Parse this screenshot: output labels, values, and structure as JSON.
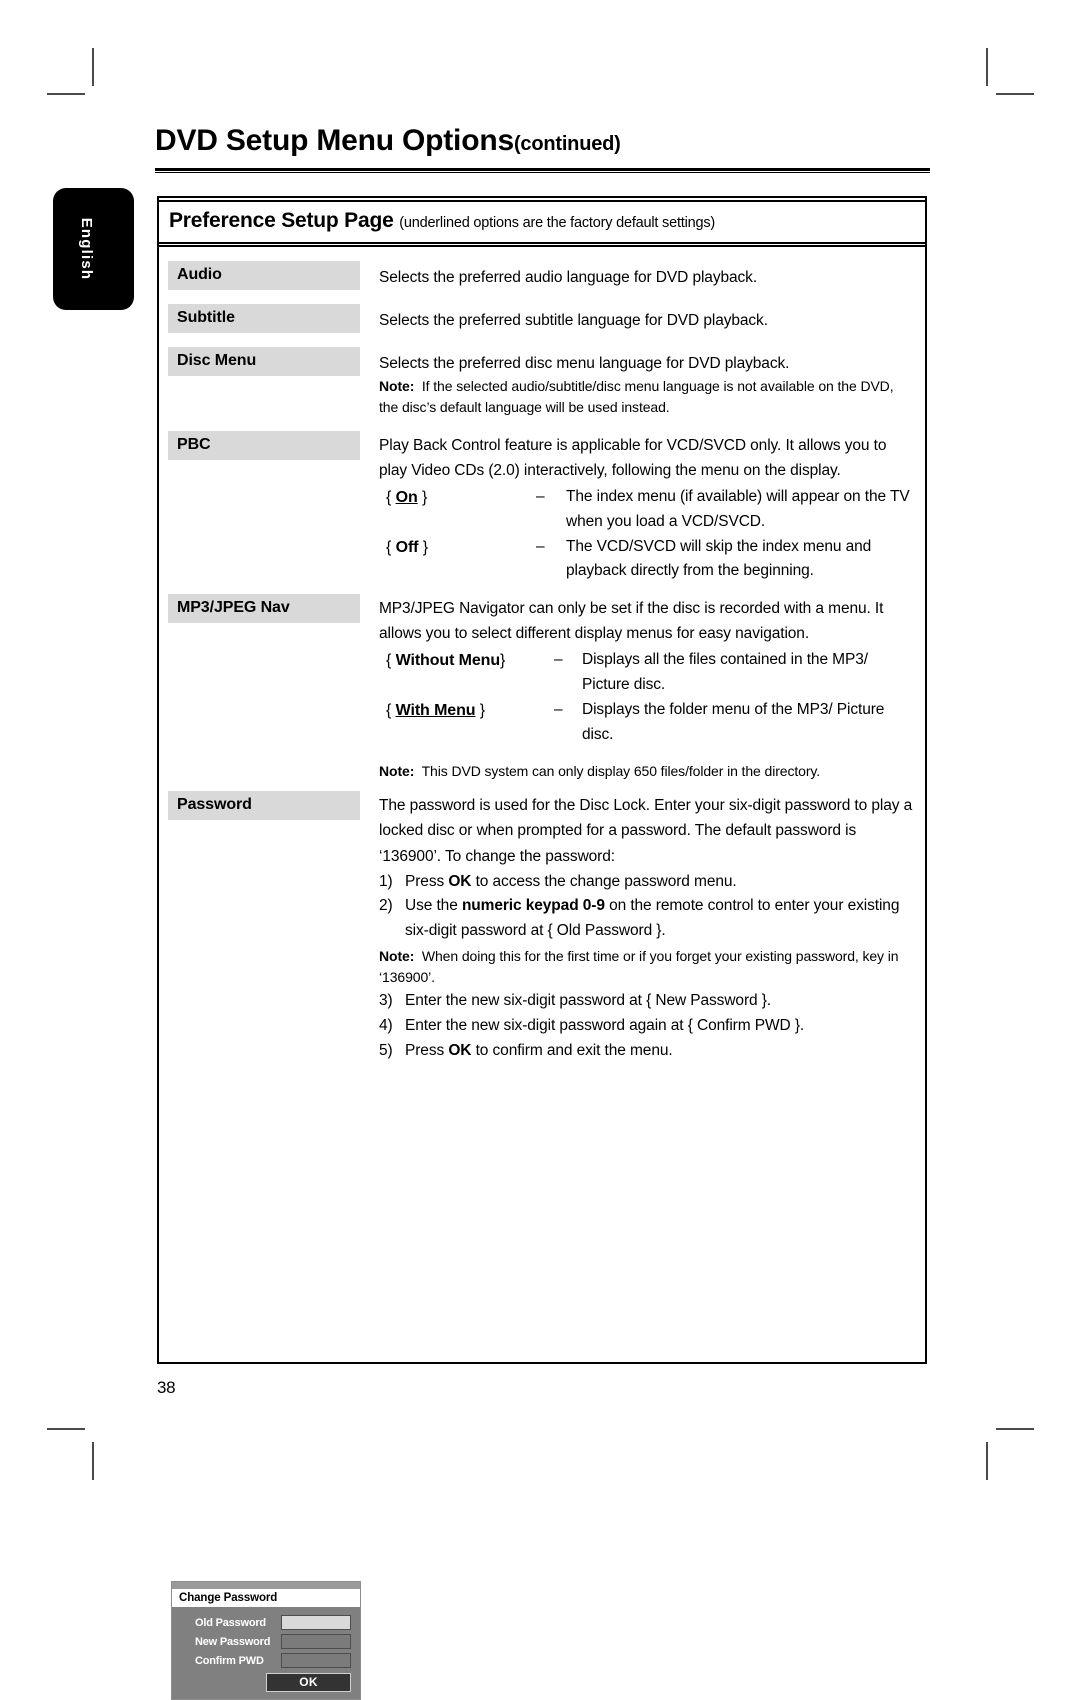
{
  "page": {
    "title": "DVD Setup Menu Options",
    "title_suffix": "(continued)",
    "page_number": "38",
    "language_tab": "English"
  },
  "section": {
    "heading": "Preference Setup Page",
    "heading_note": "(underlined options are the factory default settings)"
  },
  "rows": [
    {
      "label": "Audio",
      "description": "Selects the preferred audio language for DVD playback."
    },
    {
      "label": "Subtitle",
      "description": "Selects the preferred subtitle language for DVD playback."
    },
    {
      "label": "Disc Menu",
      "description": "Selects the preferred disc menu language for DVD playback.",
      "note_label": "Note:",
      "note_text": "If the selected audio/subtitle/disc menu language is not available on the DVD, the disc’s default language will be used instead."
    },
    {
      "label": "PBC",
      "description": "Play Back Control feature is applicable for VCD/SVCD only.  It allows you to play Video CDs (2.0) interactively, following the menu on the display.",
      "options": [
        {
          "open": "{",
          "value": "On",
          "close": "}",
          "underlined": true,
          "dash": "–",
          "text": "The index menu (if available) will appear on the TV when you load a VCD/SVCD."
        },
        {
          "open": "{",
          "value": "Off",
          "close": "}",
          "underlined": false,
          "dash": "–",
          "text": "The VCD/SVCD will skip the index menu and playback directly from the beginning."
        }
      ]
    },
    {
      "label": "MP3/JPEG Nav",
      "description": "MP3/JPEG Navigator can only be set if the disc is recorded with a menu.  It allows you to select different display menus for easy navigation.",
      "options": [
        {
          "open": "{",
          "value": "Without Menu",
          "close": "}",
          "underlined": false,
          "dash": "–",
          "text": "Displays all the files contained in the MP3/ Picture disc."
        },
        {
          "open": "{",
          "value": "With Menu",
          "close": "}",
          "underlined": true,
          "dash": "–",
          "text": "Displays the folder menu of the MP3/ Picture disc."
        }
      ],
      "note_label": "Note:",
      "note_text": "This DVD system can only display 650 files/folder in the directory."
    },
    {
      "label": "Password",
      "description": "The password is used for the Disc Lock.  Enter your six-digit password to play a locked disc or when prompted for a password.  The default password is ‘136900’.  To change the password:"
    }
  ],
  "password_steps": {
    "step1": {
      "num": "1)",
      "pre": "Press ",
      "strong": "OK",
      "post": " to access the change password menu."
    },
    "step2": {
      "num": "2)",
      "pre": "Use the ",
      "strong": "numeric keypad 0-9",
      "post": " on the remote control to enter your existing six-digit password at { Old Password }."
    },
    "note_label": "Note:",
    "note_text": "When doing this for the first time or if you forget your existing password, key in ‘136900’.",
    "step3": {
      "num": "3)",
      "pre": "Enter the new six-digit password at { New Password }.",
      "strong": "",
      "post": ""
    },
    "step4": {
      "num": "4)",
      "pre": "Enter the new six-digit password again at { Confirm PWD }.",
      "strong": "",
      "post": ""
    },
    "step5": {
      "num": "5)",
      "pre": "Press ",
      "strong": "OK",
      "post": " to confirm and exit the menu."
    }
  },
  "password_dialog": {
    "title": "Change Password",
    "fields": [
      {
        "label": "Old Password",
        "value": "",
        "active": true
      },
      {
        "label": "New Password",
        "value": "",
        "active": false
      },
      {
        "label": "Confirm PWD",
        "value": "",
        "active": false
      }
    ],
    "ok_label": "OK"
  }
}
